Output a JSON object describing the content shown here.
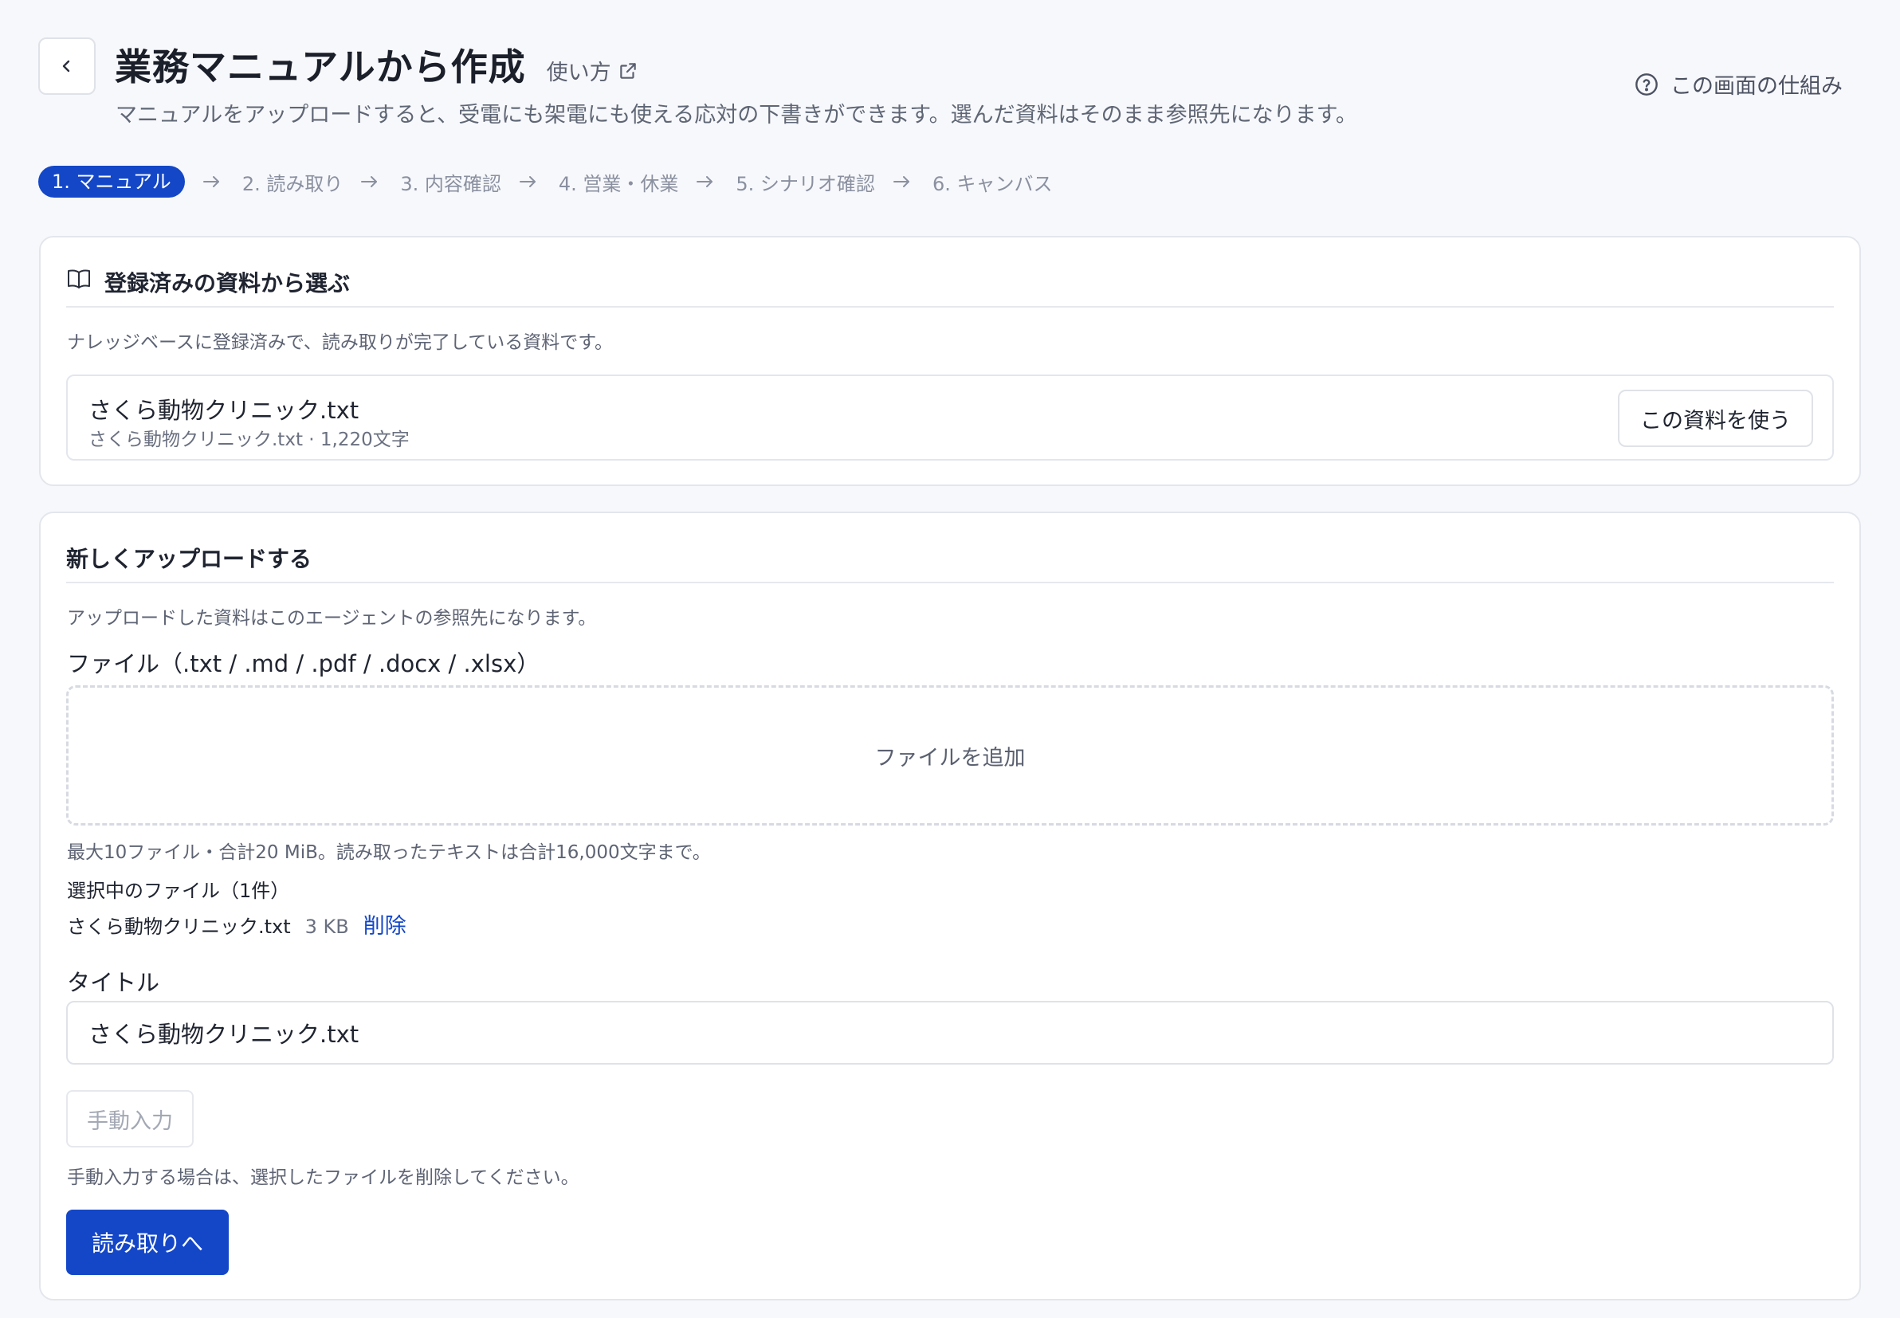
{
  "header": {
    "title": "業務マニュアルから作成",
    "howto_label": "使い方",
    "subtitle": "マニュアルをアップロードすると、受電にも架電にも使える応対の下書きができます。選んだ資料はそのまま参照先になります。",
    "how_it_works_label": "この画面の仕組み"
  },
  "stepper": {
    "steps": [
      "1. マニュアル",
      "2. 読み取り",
      "3. 内容確認",
      "4. 営業・休業",
      "5. シナリオ確認",
      "6. キャンバス"
    ],
    "active_index": 0
  },
  "registered": {
    "title": "登録済みの資料から選ぶ",
    "description": "ナレッジベースに登録済みで、読み取りが完了している資料です。",
    "items": [
      {
        "name": "さくら動物クリニック.txt",
        "meta": "さくら動物クリニック.txt · 1,220文字",
        "button": "この資料を使う"
      }
    ]
  },
  "upload": {
    "title": "新しくアップロードする",
    "description": "アップロードした資料はこのエージェントの参照先になります。",
    "file_label": "ファイル（.txt / .md / .pdf / .docx / .xlsx）",
    "dropzone_label": "ファイルを追加",
    "limits_hint": "最大10ファイル・合計20 MiB。読み取ったテキストは合計16,000文字まで。",
    "selected_heading": "選択中のファイル（1件）",
    "selected_files": [
      {
        "name": "さくら動物クリニック.txt",
        "size": "3 KB",
        "delete": "削除"
      }
    ],
    "title_label": "タイトル",
    "title_value": "さくら動物クリニック.txt",
    "manual_button": "手動入力",
    "manual_hint": "手動入力する場合は、選択したファイルを削除してください。",
    "next_button": "読み取りへ"
  },
  "colors": {
    "primary": "#1447c8",
    "background": "#f7f8fb",
    "card_border": "#e3e6ec"
  }
}
